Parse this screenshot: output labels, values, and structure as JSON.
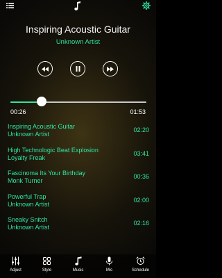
{
  "colors": {
    "accent": "#2ee6a4",
    "text": "#ffffff",
    "background": "#1a160b"
  },
  "header": {
    "menu_icon": "list-icon",
    "center_icon": "music-note-icon",
    "settings_icon": "gear-icon"
  },
  "now_playing": {
    "title": "Inspiring Acoustic Guitar",
    "artist": "Unknown Artist"
  },
  "controls": {
    "previous_icon": "rewind-icon",
    "pause_icon": "pause-icon",
    "next_icon": "fast-forward-icon"
  },
  "progress": {
    "elapsed": "00:26",
    "total": "01:53",
    "fraction": 0.23
  },
  "playlist": [
    {
      "title": "Inspiring Acoustic Guitar",
      "artist": "Unknown Artist",
      "duration": "02:20"
    },
    {
      "title": "High Technologic Beat Explosion",
      "artist": "Loyalty Freak",
      "duration": "03:41"
    },
    {
      "title": "Fascinoma Its Your Birthday",
      "artist": "Monk Turner",
      "duration": "00:36"
    },
    {
      "title": "Powerful Trap",
      "artist": "Unknown Artist",
      "duration": "02:00"
    },
    {
      "title": "Sneaky Snitch",
      "artist": "Unknown Artist",
      "duration": "02:16"
    }
  ],
  "tabbar": {
    "tabs": [
      {
        "label": "Adjust",
        "icon": "sliders-icon"
      },
      {
        "label": "Style",
        "icon": "grid-icon"
      },
      {
        "label": "Music",
        "icon": "music-note-icon"
      },
      {
        "label": "Mic",
        "icon": "microphone-icon"
      },
      {
        "label": "Schedule",
        "icon": "alarm-clock-icon"
      }
    ]
  }
}
